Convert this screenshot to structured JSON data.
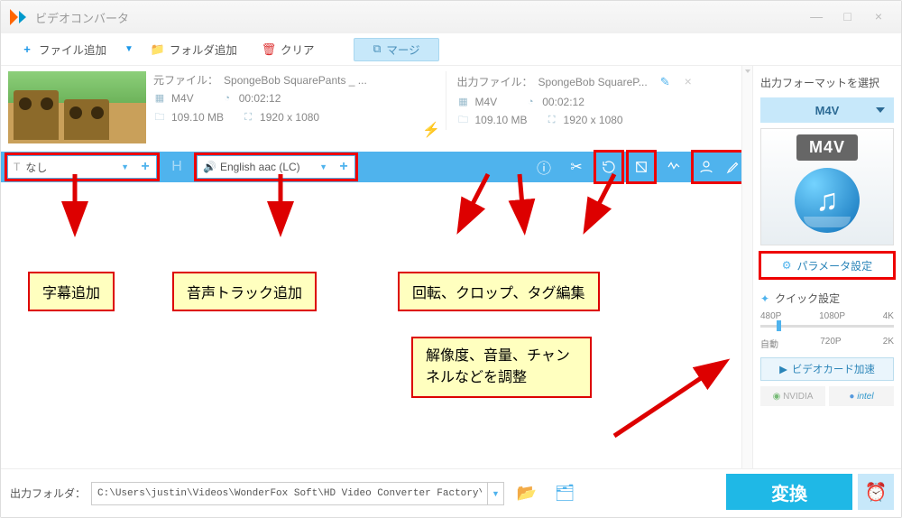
{
  "title": "ビデオコンバータ",
  "toolbar": {
    "add_file": "ファイル追加",
    "add_folder": "フォルダ追加",
    "clear": "クリア",
    "merge": "マージ"
  },
  "file": {
    "src_label": "元ファイル：",
    "src_name": "SpongeBob SquarePants _ ...",
    "out_label": "出力ファイル：",
    "out_name": "SpongeBob SquareP...",
    "format": "M4V",
    "duration": "00:02:12",
    "size": "109.10 MB",
    "resolution": "1920 x 1080"
  },
  "editbar": {
    "subtitle_none": "なし",
    "audio_track": "English aac (LC)"
  },
  "side": {
    "header": "出力フォーマットを選択",
    "format": "M4V",
    "badge": "M4V",
    "params": "パラメータ設定",
    "quick": "クイック設定",
    "res_480": "480P",
    "res_1080": "1080P",
    "res_4k": "4K",
    "res_auto": "自動",
    "res_720": "720P",
    "res_2k": "2K",
    "gpu": "ビデオカード加速",
    "nvidia": "NVIDIA",
    "intel": "intel"
  },
  "footer": {
    "label": "出力フォルダ：",
    "path": "C:\\Users\\justin\\Videos\\WonderFox Soft\\HD Video Converter Factory\\OutputVideo\\",
    "convert": "変換"
  },
  "annotations": {
    "subtitle": "字幕追加",
    "audio": "音声トラック追加",
    "rotate_crop_tag": "回転、クロップ、タグ編集",
    "resolution_etc": "解像度、音量、チャンネルなどを調整"
  }
}
